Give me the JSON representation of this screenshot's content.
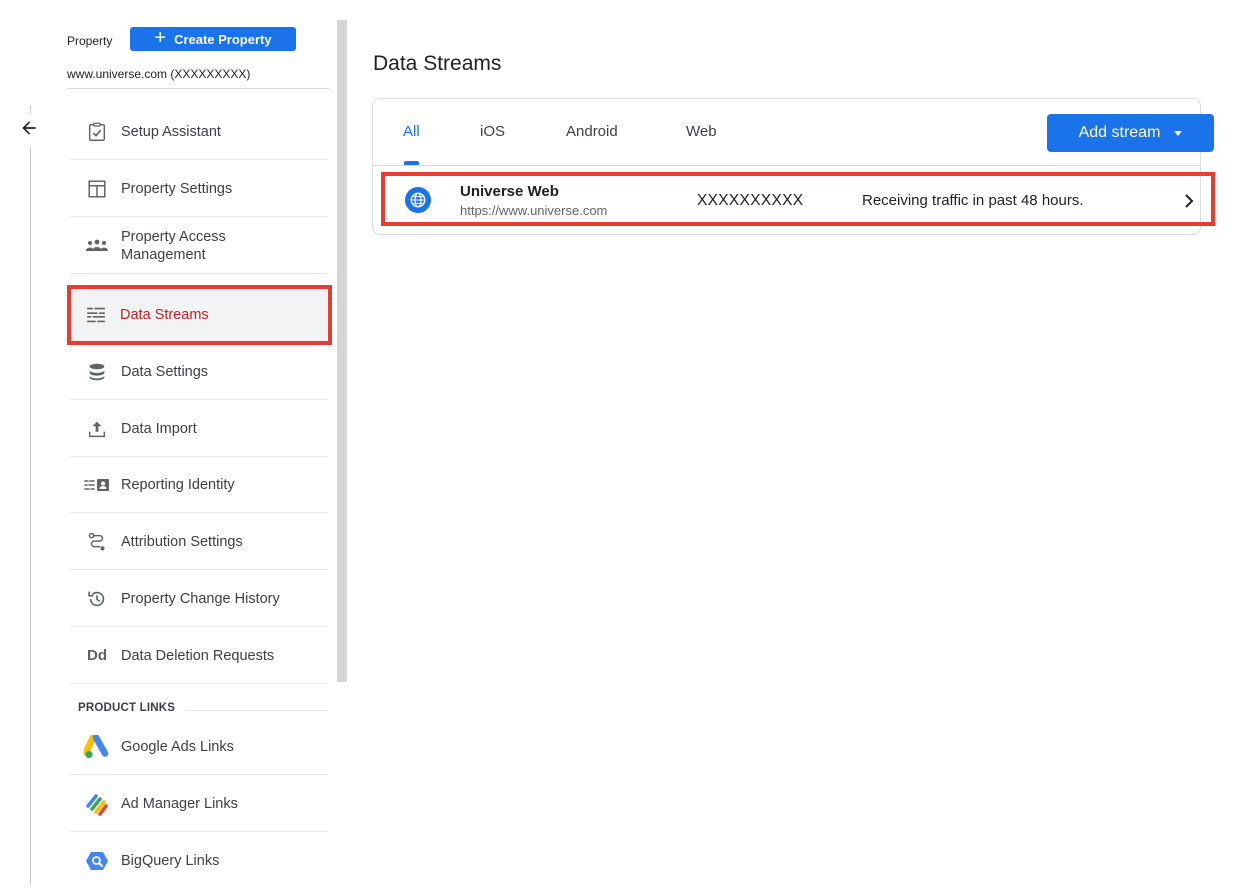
{
  "property": {
    "label": "Property",
    "create_label": "Create Property",
    "create_icon": "+",
    "name": "www.universe.com (XXXXXXXXX)"
  },
  "sidebar": {
    "items": [
      {
        "label": "Setup Assistant",
        "icon": "clipboard-check-icon"
      },
      {
        "label": "Property Settings",
        "icon": "layout-icon"
      },
      {
        "label": "Property Access Management",
        "icon": "people-icon"
      },
      {
        "label": "Data Streams",
        "icon": "streams-icon",
        "active": true
      },
      {
        "label": "Data Settings",
        "icon": "database-icon"
      },
      {
        "label": "Data Import",
        "icon": "upload-icon"
      },
      {
        "label": "Reporting Identity",
        "icon": "identity-icon"
      },
      {
        "label": "Attribution Settings",
        "icon": "path-icon"
      },
      {
        "label": "Property Change History",
        "icon": "history-icon"
      },
      {
        "label": "Data Deletion Requests",
        "icon": "dd-icon",
        "icon_text": "Dd"
      }
    ],
    "product_links_title": "PRODUCT LINKS",
    "product_links": [
      {
        "label": "Google Ads Links",
        "icon": "google-ads-icon"
      },
      {
        "label": "Ad Manager Links",
        "icon": "ad-manager-icon"
      },
      {
        "label": "BigQuery Links",
        "icon": "bigquery-icon"
      }
    ]
  },
  "main": {
    "title": "Data Streams",
    "tabs": [
      {
        "label": "All",
        "active": true
      },
      {
        "label": "iOS"
      },
      {
        "label": "Android"
      },
      {
        "label": "Web"
      }
    ],
    "add_stream_label": "Add stream",
    "streams": [
      {
        "name": "Universe Web",
        "url": "https://www.universe.com",
        "id": "XXXXXXXXXX",
        "status": "Receiving traffic in past 48 hours."
      }
    ]
  },
  "colors": {
    "accent": "#1a73e8",
    "highlight": "#e53e30",
    "active_text": "#c5221f"
  }
}
